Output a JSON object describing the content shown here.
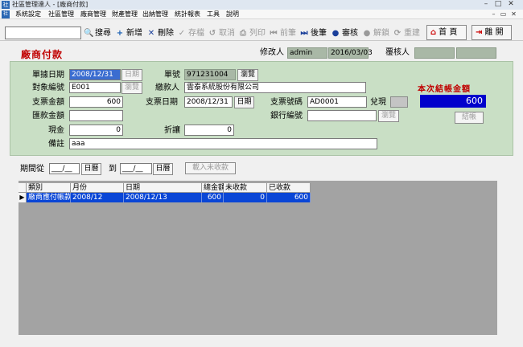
{
  "window": {
    "title": "社區管理達人 - [廠商付款]",
    "app_icon_text": "社"
  },
  "menu": [
    "系統設定",
    "社區管理",
    "廠商管理",
    "財產管理",
    "出納管理",
    "統計報表",
    "工具",
    "說明"
  ],
  "toolbar": {
    "search_value": "",
    "search": "搜尋",
    "add": "新增",
    "delete": "刪除",
    "save": "存檔",
    "cancel": "取消",
    "print": "列印",
    "prev": "前筆",
    "next": "後筆",
    "audit": "審核",
    "unlock": "解鎖",
    "redo": "重建",
    "home": "首 頁",
    "exit": "離 開"
  },
  "page": {
    "title": "廠商付款"
  },
  "header": {
    "modifier_label": "修改人",
    "modifier_value": "admin",
    "modifier_date": "2016/03/03",
    "reviewer_label": "覆核人",
    "reviewer_value": "",
    "reviewer_date": ""
  },
  "form": {
    "doc_date_label": "單據日期",
    "doc_date": "2008/12/31",
    "date_btn": "日期",
    "doc_no_label": "單號",
    "doc_no": "971231004",
    "browse_btn": "瀏覽",
    "vendor_code_label": "對象編號",
    "vendor_code": "E001",
    "payee_label": "繳款人",
    "payee": "雲泰系統股份有限公司",
    "check_amount_label": "支票金額",
    "check_amount": "600",
    "check_date_label": "支票日期",
    "check_date": "2008/12/31",
    "check_no_label": "支票號碼",
    "check_no": "AD0001",
    "cashed_label": "兌現",
    "remit_amount_label": "匯款金額",
    "remit_amount": "",
    "bank_code_label": "銀行編號",
    "bank_code": "",
    "cash_label": "現金",
    "cash": "0",
    "discount_label": "折讓",
    "discount": "0",
    "note_label": "備註",
    "note": "aaa",
    "settle_label": "本次結帳金額",
    "settle_amount": "600",
    "settle_btn": "結帳"
  },
  "period": {
    "from_label": "期間從",
    "from_value": "___/__",
    "calendar_btn": "日曆",
    "to_label": "到",
    "to_value": "___/__",
    "load_btn": "載入未收款"
  },
  "grid": {
    "columns": [
      "類別",
      "月份",
      "日期",
      "總金額",
      "未收款",
      "已收款"
    ],
    "rows": [
      [
        "廠商應付帳款",
        "2008/12",
        "2008/12/13",
        "600",
        "0",
        "600"
      ]
    ]
  },
  "colors": {
    "accent_red": "#c00000",
    "panel_green": "#c9dfc5",
    "selection_blue": "#0a46d6",
    "settle_bg": "#0000cc"
  }
}
